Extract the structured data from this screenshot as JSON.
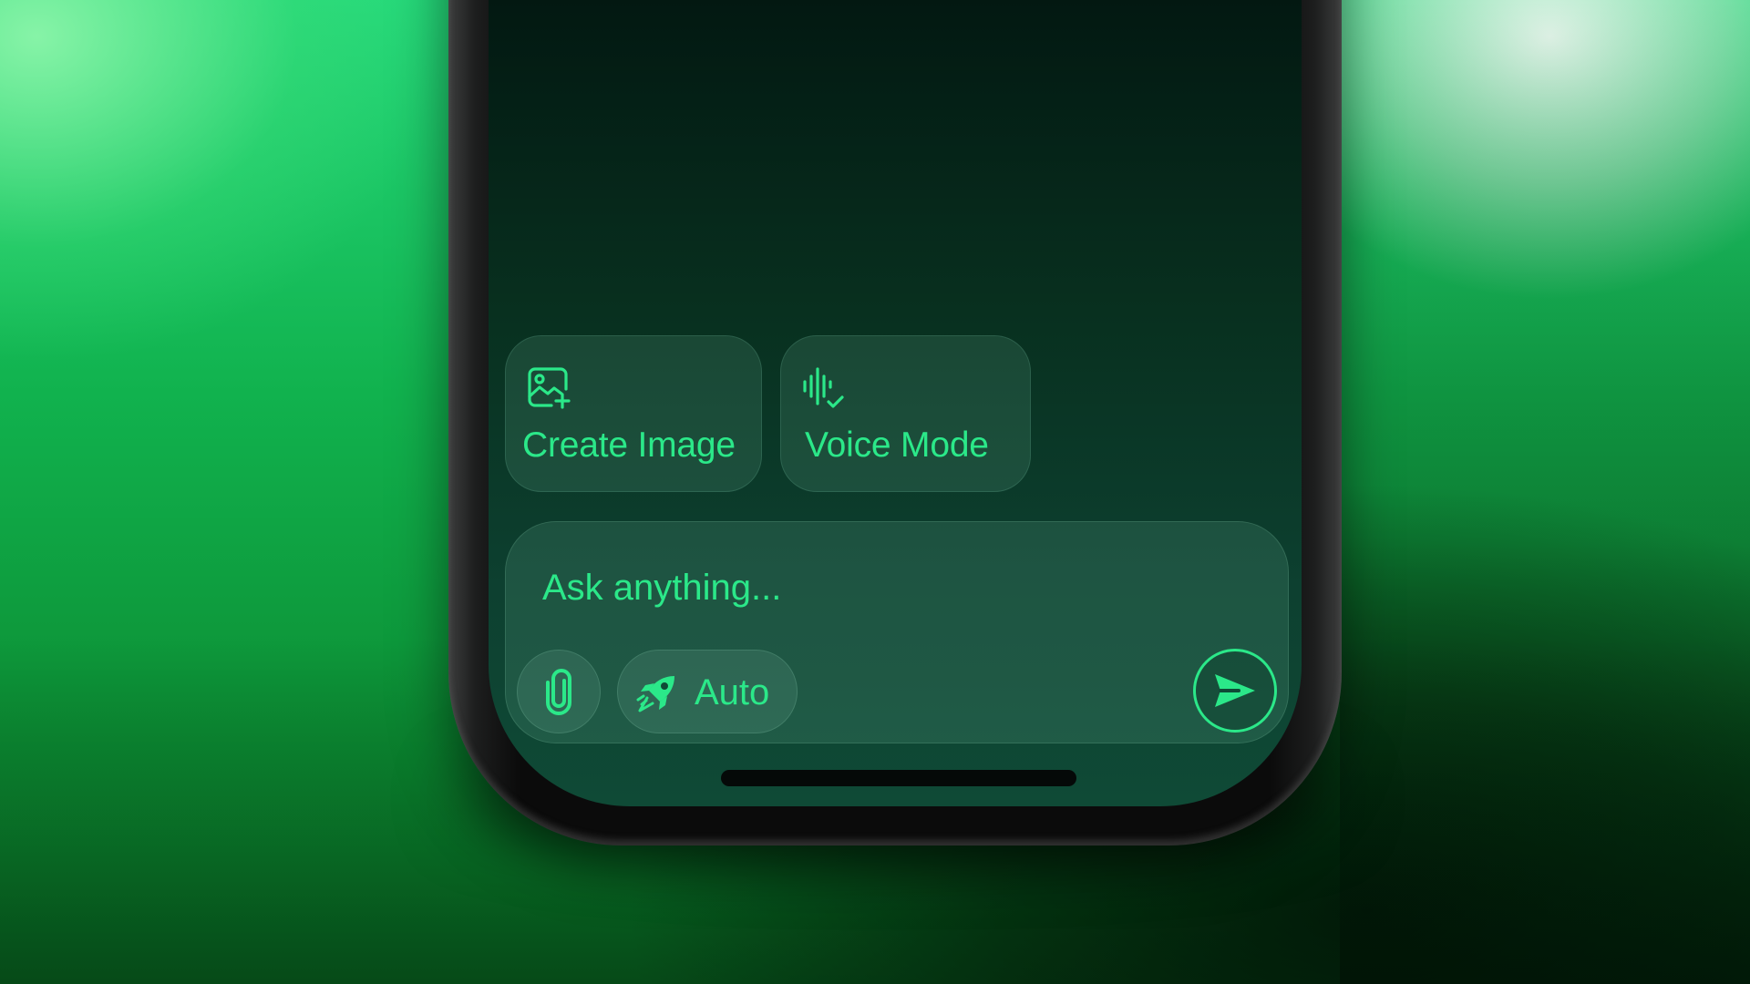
{
  "suggestions": [
    {
      "label": "Create Image",
      "icon": "image-plus-icon"
    },
    {
      "label": "Voice Mode",
      "icon": "voice-wave-icon"
    }
  ],
  "composer": {
    "placeholder": "Ask anything...",
    "attach_icon": "paperclip-icon",
    "model_selector": {
      "label": "Auto",
      "icon": "rocket-icon"
    },
    "send_icon": "send-arrow-icon"
  },
  "colors": {
    "accent": "#2be889",
    "screen_bottom": "#0f4a36",
    "background_green": "#11b24e"
  }
}
